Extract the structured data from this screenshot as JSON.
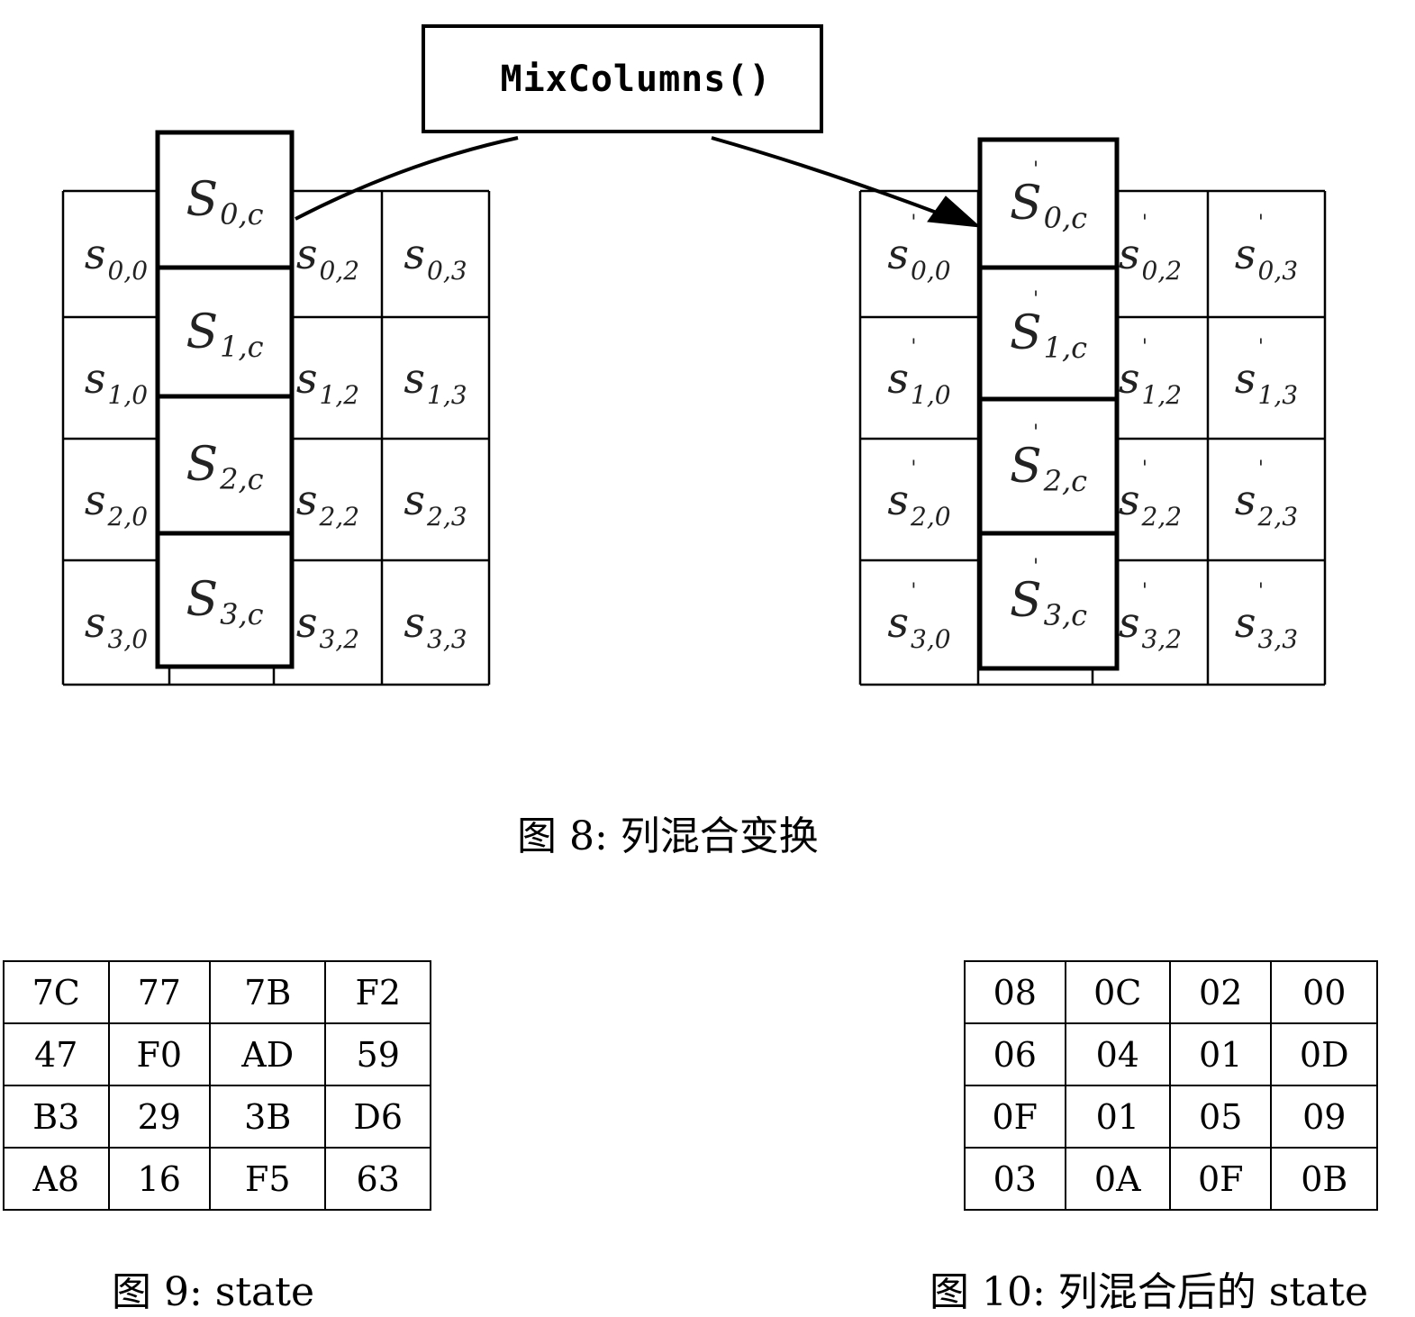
{
  "figure8": {
    "function_label": "MixColumns()",
    "left_state": {
      "rows": [
        [
          {
            "base": "s",
            "sub": "0,0"
          },
          {
            "base": "S",
            "sub": "0,c"
          },
          {
            "base": "s",
            "sub": "0,2"
          },
          {
            "base": "s",
            "sub": "0,3"
          }
        ],
        [
          {
            "base": "s",
            "sub": "1,0"
          },
          {
            "base": "S",
            "sub": "1,c"
          },
          {
            "base": "s",
            "sub": "1,2"
          },
          {
            "base": "s",
            "sub": "1,3"
          }
        ],
        [
          {
            "base": "s",
            "sub": "2,0"
          },
          {
            "base": "S",
            "sub": "2,c"
          },
          {
            "base": "s",
            "sub": "2,2"
          },
          {
            "base": "s",
            "sub": "2,3"
          }
        ],
        [
          {
            "base": "s",
            "sub": "3,0"
          },
          {
            "base": "S",
            "sub": "3,c"
          },
          {
            "base": "s",
            "sub": "3,2"
          },
          {
            "base": "s",
            "sub": "3,3"
          }
        ]
      ]
    },
    "right_state": {
      "prime_mark": "'",
      "rows": [
        [
          {
            "base": "s",
            "sub": "0,0"
          },
          {
            "base": "S",
            "sub": "0,c"
          },
          {
            "base": "s",
            "sub": "0,2"
          },
          {
            "base": "s",
            "sub": "0,3"
          }
        ],
        [
          {
            "base": "s",
            "sub": "1,0"
          },
          {
            "base": "S",
            "sub": "1,c"
          },
          {
            "base": "s",
            "sub": "1,2"
          },
          {
            "base": "s",
            "sub": "1,3"
          }
        ],
        [
          {
            "base": "s",
            "sub": "2,0"
          },
          {
            "base": "S",
            "sub": "2,c"
          },
          {
            "base": "s",
            "sub": "2,2"
          },
          {
            "base": "s",
            "sub": "2,3"
          }
        ],
        [
          {
            "base": "s",
            "sub": "3,0"
          },
          {
            "base": "S",
            "sub": "3,c"
          },
          {
            "base": "s",
            "sub": "3,2"
          },
          {
            "base": "s",
            "sub": "3,3"
          }
        ]
      ]
    },
    "caption": "图 8: 列混合变换"
  },
  "figure9": {
    "rows": [
      [
        "7C",
        "77",
        "7B",
        "F2"
      ],
      [
        "47",
        "F0",
        "AD",
        "59"
      ],
      [
        "B3",
        "29",
        "3B",
        "D6"
      ],
      [
        "A8",
        "16",
        "F5",
        "63"
      ]
    ],
    "caption": "图 9: state"
  },
  "figure10": {
    "rows": [
      [
        "08",
        "0C",
        "02",
        "00"
      ],
      [
        "06",
        "04",
        "01",
        "0D"
      ],
      [
        "0F",
        "01",
        "05",
        "09"
      ],
      [
        "03",
        "0A",
        "0F",
        "0B"
      ]
    ],
    "caption": "图 10: 列混合后的 state"
  }
}
